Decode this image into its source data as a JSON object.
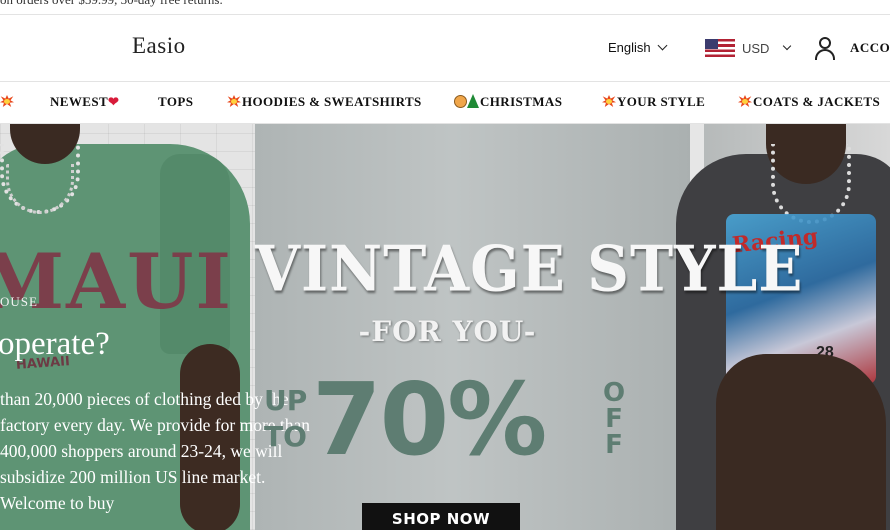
{
  "announcement": {
    "text": "on orders over $59.99, 30-day free returns."
  },
  "header": {
    "logo": "Easio",
    "language": "English",
    "currency": "USD",
    "account_label": "ACCO",
    "flag_icon": "us-flag-icon",
    "account_icon": "user-icon"
  },
  "nav": {
    "items": [
      {
        "label": "",
        "icon": "collision-icon"
      },
      {
        "label": "NEWEST",
        "icon": "heart-icon"
      },
      {
        "label": "TOPS"
      },
      {
        "label": "HOODIES & SWEATSHIRTS",
        "icon": "collision-icon"
      },
      {
        "label": "CHRISTMAS",
        "icon": "face-tree-icon"
      },
      {
        "label": "YOUR STYLE",
        "icon": "collision-icon"
      },
      {
        "label": "COATS & JACKETS",
        "icon": "collision-icon"
      }
    ],
    "heart_glyph": "❤"
  },
  "hero": {
    "shirt_left_text": "MAUI",
    "shirt_left_sub": "HAWAII",
    "shirt_right_text": "Racing",
    "car_number": "28",
    "title": "VINTAGE STYLE",
    "subtitle": "-FOR YOU-",
    "up": "UP",
    "to": "TO",
    "percent": "70%",
    "off": [
      "O",
      "F",
      "F"
    ],
    "cta": "SHOP NOW",
    "colors": {
      "accent": "#5e7d72",
      "cta_bg": "#111111"
    }
  },
  "about": {
    "eyebrow": "OUSE",
    "question": "operate?",
    "paragraph": "than 20,000 pieces of clothing ded by the factory every day. We provide for more than 400,000 shoppers around 23-24, we will subsidize 200 million US line market. Welcome to buy"
  }
}
